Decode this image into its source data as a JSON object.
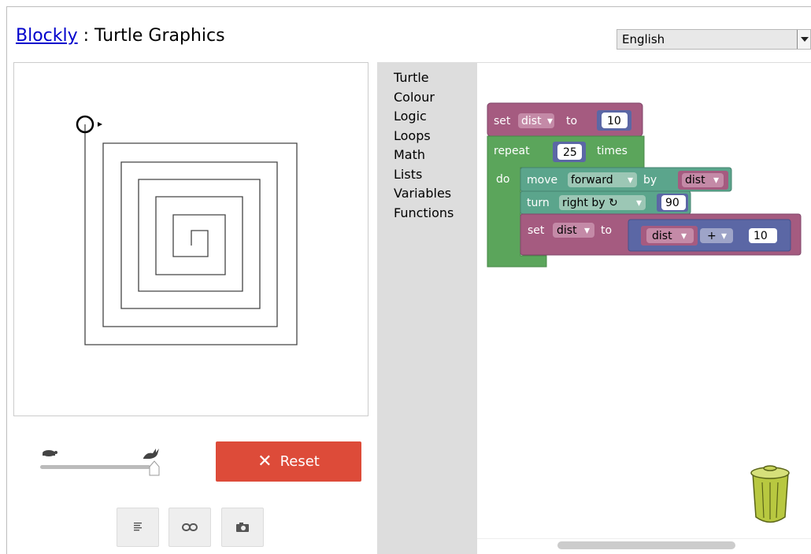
{
  "header": {
    "link_text": "Blockly",
    "separator": " : ",
    "title": "Turtle Graphics"
  },
  "language_select": {
    "selected": "English"
  },
  "controls": {
    "slider_icons": [
      "turtle-icon",
      "rabbit-icon"
    ],
    "speed": 1.0,
    "reset_label": "Reset",
    "buttons": [
      "code-icon",
      "link-icon",
      "camera-icon"
    ]
  },
  "toolbox": {
    "categories": [
      "Turtle",
      "Colour",
      "Logic",
      "Loops",
      "Math",
      "Lists",
      "Variables",
      "Functions"
    ]
  },
  "blocks": {
    "set1": {
      "set": "set",
      "var": "dist",
      "to": "to",
      "value": "10"
    },
    "repeat": {
      "repeat": "repeat",
      "count": "25",
      "times": "times",
      "do": "do"
    },
    "move": {
      "move": "move",
      "dir": "forward",
      "by": "by",
      "var": "dist"
    },
    "turn": {
      "turn": "turn",
      "dir": "right by ↻",
      "value": "90"
    },
    "set2": {
      "set": "set",
      "var": "dist",
      "to": "to",
      "lhs": "dist",
      "op": "+",
      "rhs": "10"
    }
  },
  "colors": {
    "variables": "#a55b80",
    "loops": "#5ba55b",
    "turtle": "#5ba58c",
    "math": "#5b67a5",
    "reset": "#dd4b39"
  }
}
